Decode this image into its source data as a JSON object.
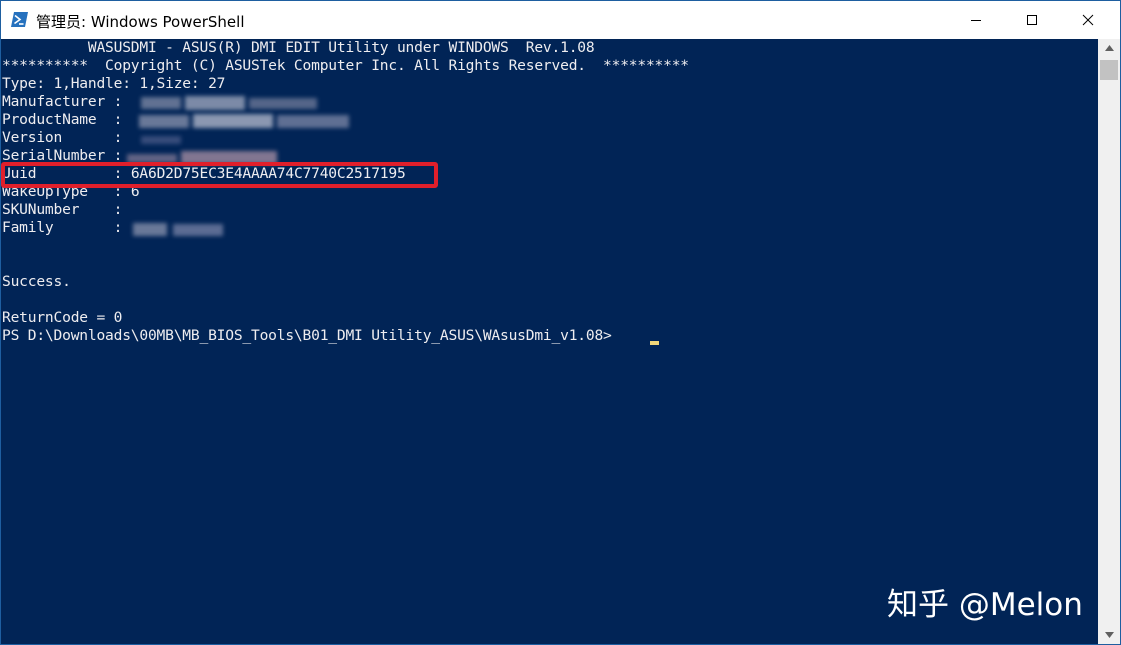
{
  "window": {
    "title": "管理员: Windows PowerShell"
  },
  "console": {
    "header_line": "          WASUSDMI - ASUS(R) DMI EDIT Utility under WINDOWS  Rev.1.08",
    "copyright_line": "**********  Copyright (C) ASUSTek Computer Inc. All Rights Reserved.  **********",
    "type_line": "Type: 1,Handle: 1,Size: 27",
    "fields": [
      {
        "key": "Manufacturer",
        "label": "Manufacturer :",
        "value": ""
      },
      {
        "key": "ProductName",
        "label": "ProductName  :",
        "value": ""
      },
      {
        "key": "Version",
        "label": "Version      :",
        "value": ""
      },
      {
        "key": "SerialNumber",
        "label": "SerialNumber :",
        "value": ""
      },
      {
        "key": "Uuid",
        "label": "Uuid         :",
        "value": "6A6D2D75EC3E4AAAA74C7740C2517195"
      },
      {
        "key": "WakeUpType",
        "label": "WakeUpType   :",
        "value": "6"
      },
      {
        "key": "SKUNumber",
        "label": "SKUNumber    :",
        "value": ""
      },
      {
        "key": "Family",
        "label": "Family       :",
        "value": ""
      }
    ],
    "success_line": "Success.",
    "return_code_line": "ReturnCode = 0",
    "prompt_line": "PS D:\\Downloads\\00MB\\MB_BIOS_Tools\\B01_DMI Utility_ASUS\\WAsusDmi_v1.08>"
  },
  "watermark": {
    "text": "知乎 @Melon"
  },
  "colors": {
    "console_bg": "#012456",
    "console_text": "#eeedf0",
    "highlight_border": "#e01f2b",
    "cursor": "#f0d67a"
  },
  "icons": {
    "app_icon": "powershell-icon",
    "minimize": "minimize-icon",
    "maximize": "maximize-icon",
    "close": "close-icon",
    "scroll_up": "scroll-up-arrow-icon",
    "scroll_down": "scroll-down-arrow-icon"
  }
}
